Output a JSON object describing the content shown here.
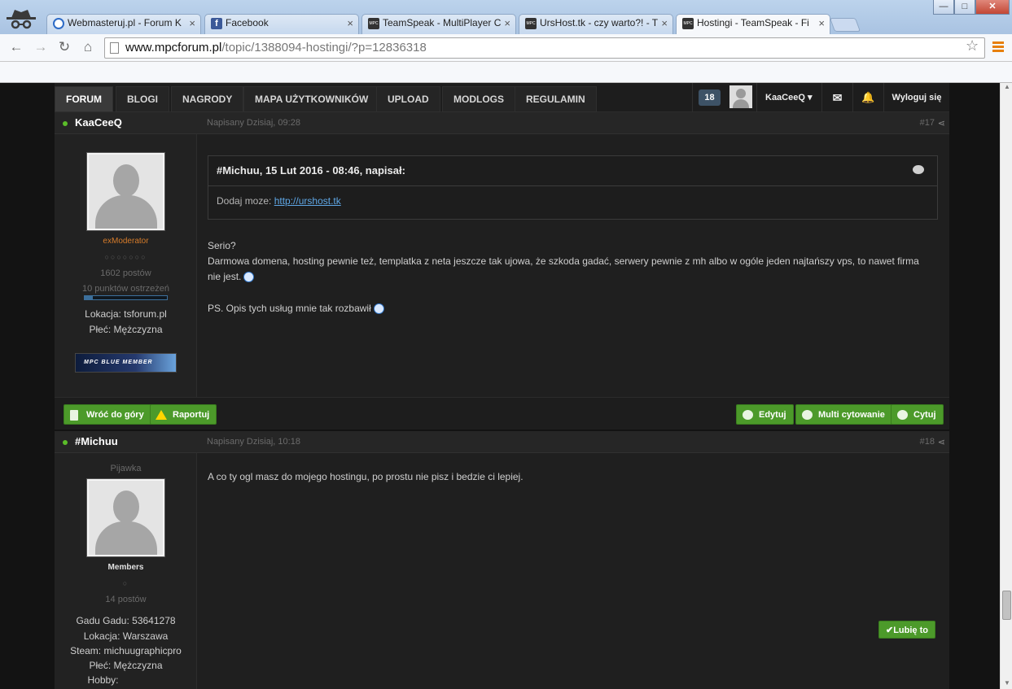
{
  "browser": {
    "tabs": [
      {
        "title": "Webmasteruj.pl - Forum K",
        "favicon": "webmasteruj-icon"
      },
      {
        "title": "Facebook",
        "favicon": "facebook-icon"
      },
      {
        "title": "TeamSpeak - MultiPlayer C",
        "favicon": "mpc-icon"
      },
      {
        "title": "UrsHost.tk - czy warto?! - T",
        "favicon": "mpc-icon"
      },
      {
        "title": "Hostingi - TeamSpeak - Fi",
        "favicon": "mpc-icon"
      }
    ],
    "url_host": "www.mpcforum.pl",
    "url_path": "/topic/1388094-hostingi/?p=12836318"
  },
  "nav": {
    "items": [
      "FORUM",
      "BLOGI",
      "NAGRODY",
      "MAPA UŻYTKOWNIKÓW",
      "UPLOAD",
      "MODLOGS",
      "REGULAMIN"
    ],
    "notif_count": "18",
    "username": "KaaCeeQ",
    "logout": "Wyloguj się"
  },
  "posts": [
    {
      "author": "KaaCeeQ",
      "date": "Napisany Dzisiaj, 09:28",
      "number": "#17",
      "rank": "exModerator",
      "pips": "○○○○○○○",
      "post_count": "1602 postów",
      "warnings": "10 punktów ostrzeżeń",
      "warn_level": 0.1,
      "fields": [
        "Lokacja: tsforum.pl",
        "Płeć: Mężczyzna"
      ],
      "member_badge": "MPC BLUE MEMBER",
      "quote": {
        "header": "#Michuu, 15 Lut 2016 - 08:46, napisał:",
        "text": "Dodaj moze: ",
        "link": "http://urshost.tk"
      },
      "body": [
        "Serio?",
        "Darmowa domena, hosting pewnie też, templatka z neta jeszcze tak ujowa, że szkoda gadać, serwery pewnie z mh albo w ogóle jeden najtańszy vps, to nawet firma",
        "nie jest.",
        "PS. Opis tych usług mnie tak rozbawił"
      ],
      "buttons": {
        "top": "Wróć do góry",
        "report": "Raportuj",
        "edit": "Edytuj",
        "multi": "Multi cytowanie",
        "quote": "Cytuj"
      }
    },
    {
      "author": "#Michuu",
      "date": "Napisany Dzisiaj, 10:18",
      "number": "#18",
      "title": "Pijawka",
      "group": "Members",
      "pips": "○",
      "post_count": "14 postów",
      "fields": [
        "Gadu Gadu: 53641278",
        "Lokacja: Warszawa",
        "Steam: michuugraphicpro",
        "Płeć: Mężczyzna",
        "Hobby:"
      ],
      "body": "A co ty ogl masz do mojego hostingu, po prostu nie pisz i bedzie ci lepiej.",
      "like": "✔Lubię to"
    }
  ]
}
